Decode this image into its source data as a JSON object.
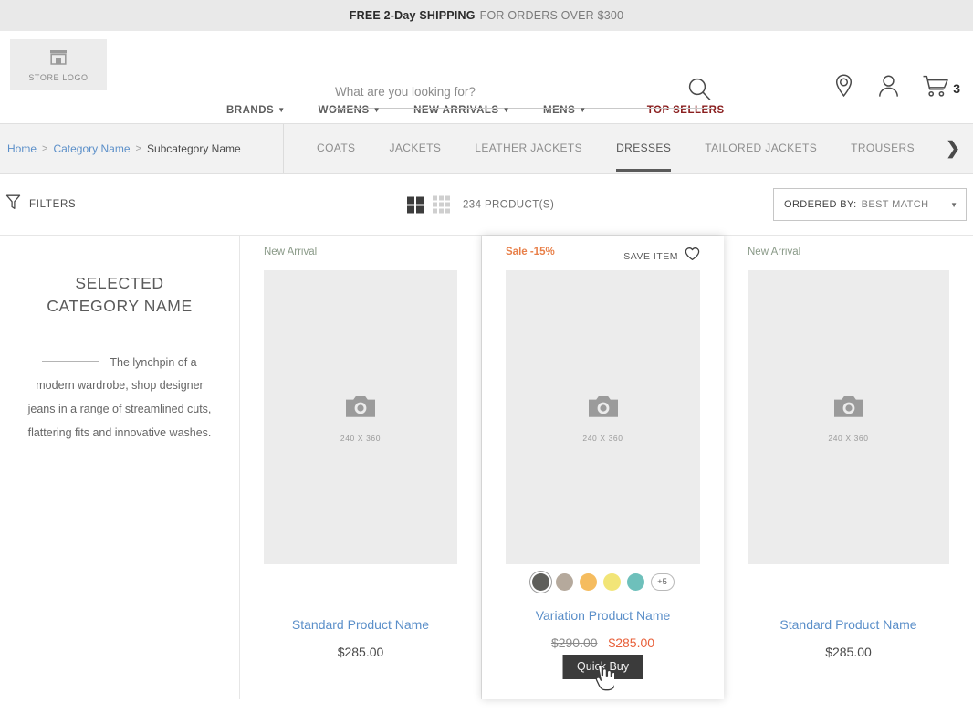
{
  "promo_banner": {
    "strong": "FREE 2-Day SHIPPING",
    "rest": "FOR ORDERS OVER $300"
  },
  "header": {
    "logo_label": "STORE LOGO",
    "logo_icon": "storefront-icon",
    "search": {
      "placeholder": "What are you looking for?",
      "value": "",
      "icon": "search-icon"
    },
    "icons": [
      {
        "name": "location-pin-icon"
      },
      {
        "name": "account-person-icon"
      },
      {
        "name": "shopping-cart-icon"
      }
    ],
    "cart_count": "3"
  },
  "main_nav": {
    "items": [
      {
        "label": "BRANDS",
        "caret": "▼",
        "highlight": false
      },
      {
        "label": "WOMENS",
        "caret": "▼",
        "highlight": false
      },
      {
        "label": "NEW ARRIVALS",
        "caret": "▼",
        "highlight": false
      },
      {
        "label": "MENS",
        "caret": "▼",
        "highlight": false
      },
      {
        "label": "TOP SELLERS",
        "caret": "",
        "highlight": true
      }
    ],
    "highlight_color": "#8a1f1f"
  },
  "breadcrumb": {
    "home": "Home",
    "sep1": ">",
    "category": "Category Name",
    "sep2": ">",
    "current": "Subcategory Name",
    "link_color": "#5b8fc9"
  },
  "category_tabs": {
    "items": [
      {
        "label": "COATS",
        "active": false
      },
      {
        "label": "JACKETS",
        "active": false
      },
      {
        "label": "LEATHER JACKETS",
        "active": false
      },
      {
        "label": "DRESSES",
        "active": true
      },
      {
        "label": "TAILORED JACKETS",
        "active": false
      },
      {
        "label": "TROUSERS",
        "active": false
      }
    ],
    "next_arrow": "❯"
  },
  "toolbar": {
    "filters_label": "FILTERS",
    "filters_icon": "funnel-filter-icon",
    "view_grid_2_icon": "grid-2x2-icon",
    "view_grid_3_icon": "grid-3x3-icon",
    "product_count": "234 PRODUCT(S)",
    "sort_label": "ORDERED BY:",
    "sort_value": "BEST MATCH",
    "sort_caret": "▼"
  },
  "promo_cell": {
    "title": "SELECTED CATEGORY NAME",
    "description": "The lynchpin of a modern wardrobe, shop designer jeans in a range of streamlined cuts, flattering fits and innovative washes."
  },
  "products": [
    {
      "badge": "New Arrival",
      "badge_type": "new",
      "save_item_label": "",
      "image_dim": "240 X 360",
      "image_icon": "camera-placeholder-icon",
      "name": "Standard Product Name",
      "price": "$285.00",
      "old_price": "",
      "sale_price": "",
      "swatches": [],
      "hovered": false
    },
    {
      "badge": "Sale -15%",
      "badge_type": "sale",
      "save_item_label": "SAVE ITEM",
      "save_item_icon": "heart-icon",
      "image_dim": "240 X 360",
      "image_icon": "camera-placeholder-icon",
      "name": "Variation Product Name",
      "price": "",
      "old_price": "$290.00",
      "sale_price": "$285.00",
      "swatches": [
        {
          "color": "#5e5e5a",
          "selected": true
        },
        {
          "color": "#b5a99c",
          "selected": false
        },
        {
          "color": "#f5bc5f",
          "selected": false
        },
        {
          "color": "#f2e577",
          "selected": false
        },
        {
          "color": "#6ec0bb",
          "selected": false
        }
      ],
      "swatch_more": "+5",
      "quick_buy_label": "Quick Buy",
      "hovered": true
    },
    {
      "badge": "New Arrival",
      "badge_type": "new",
      "save_item_label": "",
      "image_dim": "240 X 360",
      "image_icon": "camera-placeholder-icon",
      "name": "Standard Product Name",
      "price": "$285.00",
      "old_price": "",
      "sale_price": "",
      "swatches": [],
      "hovered": false
    }
  ]
}
